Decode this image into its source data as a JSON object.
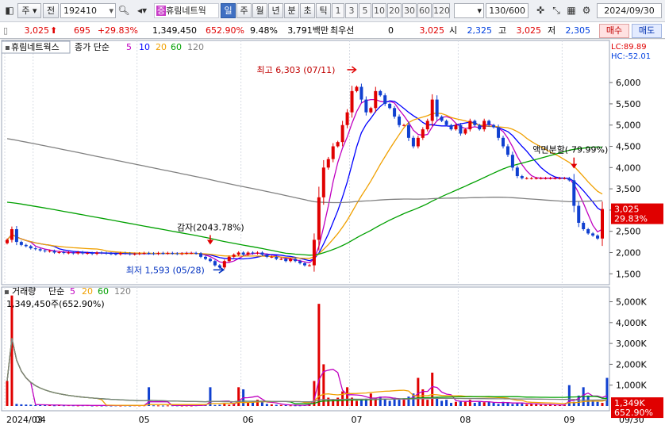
{
  "toolbar": {
    "market_label": "주",
    "prev_label": "전",
    "code_value": "192410",
    "stock_name": "휴림네트웍",
    "stock_badge": "증",
    "periods": [
      "일",
      "주",
      "월",
      "년",
      "분",
      "초",
      "틱"
    ],
    "active_period": "일",
    "minutes": [
      "1",
      "3",
      "5",
      "10",
      "20",
      "30",
      "60",
      "120"
    ],
    "count": "130/600",
    "date": "2024/09/30"
  },
  "quote": {
    "price": "3,025",
    "change": "695",
    "change_pct": "+29.83%",
    "volume": "1,349,450",
    "volume_ratio": "652.90%",
    "turnover": "9.48%",
    "amount": "3,791백만",
    "label_best": "최우선",
    "best_value": "0",
    "best_price": "3,025",
    "open_label": "시",
    "open": "2,325",
    "high_label": "고",
    "high": "3,025",
    "low_label": "저",
    "low": "2,305",
    "buy_label": "매수",
    "sell_label": "매도"
  },
  "price_panel": {
    "legend_name": "휴림네트웍스",
    "legend_ma": "종가 단순",
    "ma_periods": [
      "5",
      "10",
      "20",
      "60",
      "120"
    ],
    "lc": "LC:89.89",
    "hc": "HC:-52.01",
    "last_price_label": "3,025",
    "last_pct_label": "29.83%",
    "annot_high": "최고 6,303 (07/11)",
    "annot_low": "최저 1,593 (05/28)",
    "annot_capred": "감자(2043.78%)",
    "annot_split": "액면분할(-79.99%)"
  },
  "volume_panel": {
    "legend_name": "거래량",
    "legend_ma": "단순",
    "ma_periods": [
      "5",
      "20",
      "60",
      "120"
    ],
    "readout": "1,349,450주(652.90%)",
    "last_volume_label": "1,349K",
    "last_pct_label": "652.90%"
  },
  "x_axis": {
    "labels": [
      {
        "date": "2024/03",
        "text": "2024/03"
      },
      {
        "date": "2024/04",
        "text": "04"
      },
      {
        "date": "2024/05",
        "text": "05"
      },
      {
        "date": "2024/06",
        "text": "06"
      },
      {
        "date": "2024/07",
        "text": "07"
      },
      {
        "date": "2024/08",
        "text": "08"
      },
      {
        "date": "2024/09",
        "text": "09"
      }
    ],
    "right_label": "09/30"
  },
  "colors": {
    "up": "#e00000",
    "down": "#1040d0",
    "ma5": "#c000c0",
    "ma10": "#0000ff",
    "ma20": "#f0a000",
    "ma60": "#00a000",
    "ma120": "#808080"
  },
  "chart_data": [
    {
      "type": "candlestick",
      "title": "휴림네트웍스",
      "y_ticks": [
        1500,
        2000,
        2500,
        3000,
        3500,
        4000,
        4500,
        5000,
        5500,
        6000
      ],
      "ylim": [
        1300,
        6600
      ],
      "closes": [
        2300,
        2550,
        2250,
        2180,
        2150,
        2100,
        2080,
        2050,
        2030,
        2040,
        2000,
        2010,
        1990,
        2000,
        1980,
        2010,
        1980,
        1990,
        1970,
        2000,
        1990,
        1980,
        1970,
        1960,
        1990,
        1980,
        1960,
        1970,
        1980,
        1990,
        1980,
        1970,
        1990,
        1980,
        1990,
        1980,
        1970,
        1980,
        1990,
        1990,
        1980,
        1900,
        1850,
        1800,
        1700,
        1650,
        1800,
        1900,
        1950,
        2000,
        1950,
        2000,
        1980,
        2000,
        1950,
        1900,
        1900,
        1850,
        1850,
        1800,
        1850,
        1800,
        1750,
        1700,
        1700,
        2300,
        3300,
        4000,
        4200,
        4500,
        4600,
        5000,
        5300,
        5800,
        5900,
        5600,
        5300,
        5400,
        5800,
        5700,
        5500,
        5400,
        5200,
        5000,
        5000,
        4700,
        4500,
        4700,
        4900,
        5100,
        5600,
        5200,
        5100,
        5000,
        4900,
        5000,
        4800,
        4900,
        5100,
        5000,
        4900,
        5100,
        5000,
        4950,
        4700,
        4500,
        4300,
        4000,
        3800,
        3750,
        3750,
        3750,
        3750,
        3750,
        3750,
        3750,
        3750,
        3750,
        3750,
        3700,
        3100,
        2700,
        2550,
        2450,
        2400,
        2330,
        3025
      ],
      "highlights": [
        {
          "name": "최고",
          "value": 6303,
          "date": "07/11"
        },
        {
          "name": "최저",
          "value": 1593,
          "date": "05/28"
        }
      ],
      "series": [
        {
          "name": "5"
        },
        {
          "name": "10"
        },
        {
          "name": "20"
        },
        {
          "name": "60"
        },
        {
          "name": "120"
        }
      ]
    },
    {
      "type": "bar",
      "title": "거래량",
      "y_ticks_labels": [
        "1,000K",
        "2,000K",
        "3,000K",
        "4,000K",
        "5,000K"
      ],
      "y_ticks": [
        1000,
        2000,
        3000,
        4000,
        5000
      ],
      "ylim": [
        0,
        5400
      ],
      "values": [
        1200,
        5300,
        100,
        80,
        70,
        60,
        40,
        60,
        50,
        40,
        30,
        40,
        30,
        35,
        30,
        25,
        30,
        35,
        20,
        25,
        20,
        25,
        20,
        25,
        20,
        25,
        20,
        30,
        25,
        30,
        900,
        30,
        25,
        20,
        25,
        30,
        25,
        20,
        25,
        20,
        30,
        40,
        50,
        900,
        50,
        60,
        100,
        60,
        90,
        900,
        800,
        150,
        200,
        300,
        200,
        100,
        80,
        60,
        50,
        40,
        30,
        30,
        30,
        50,
        100,
        1200,
        4900,
        2000,
        400,
        300,
        400,
        700,
        900,
        400,
        250,
        300,
        350,
        600,
        400,
        450,
        350,
        250,
        400,
        300,
        300,
        450,
        600,
        1350,
        800,
        300,
        1600,
        400,
        250,
        300,
        150,
        200,
        250,
        200,
        300,
        150,
        200,
        180,
        200,
        150,
        100,
        200,
        180,
        100,
        150,
        120,
        80,
        120,
        80,
        60,
        50,
        70,
        50,
        40,
        40,
        1000,
        200,
        500,
        900,
        500,
        300,
        200,
        150,
        1349
      ]
    }
  ]
}
